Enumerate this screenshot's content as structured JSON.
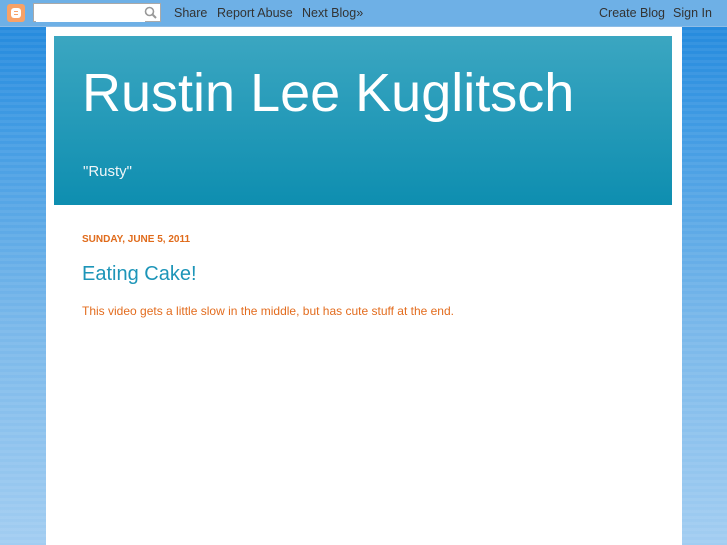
{
  "navbar": {
    "logo": "blogger-logo",
    "search": {
      "value": "",
      "placeholder": ""
    },
    "links": {
      "share": "Share",
      "report_abuse": "Report Abuse",
      "next_blog": "Next Blog»",
      "create_blog": "Create Blog",
      "sign_in": "Sign In"
    }
  },
  "blog": {
    "title": "Rustin Lee Kuglitsch",
    "description": "\"Rusty\""
  },
  "post": {
    "date": "SUNDAY, JUNE 5, 2011",
    "title": "Eating Cake!",
    "body": "This video gets a little slow in the middle, but has cute stuff at the end."
  },
  "colors": {
    "accent": "#1d95b8",
    "date": "#e06b1b",
    "header_top": "#3ba6c1",
    "header_bottom": "#0e8eb0"
  }
}
